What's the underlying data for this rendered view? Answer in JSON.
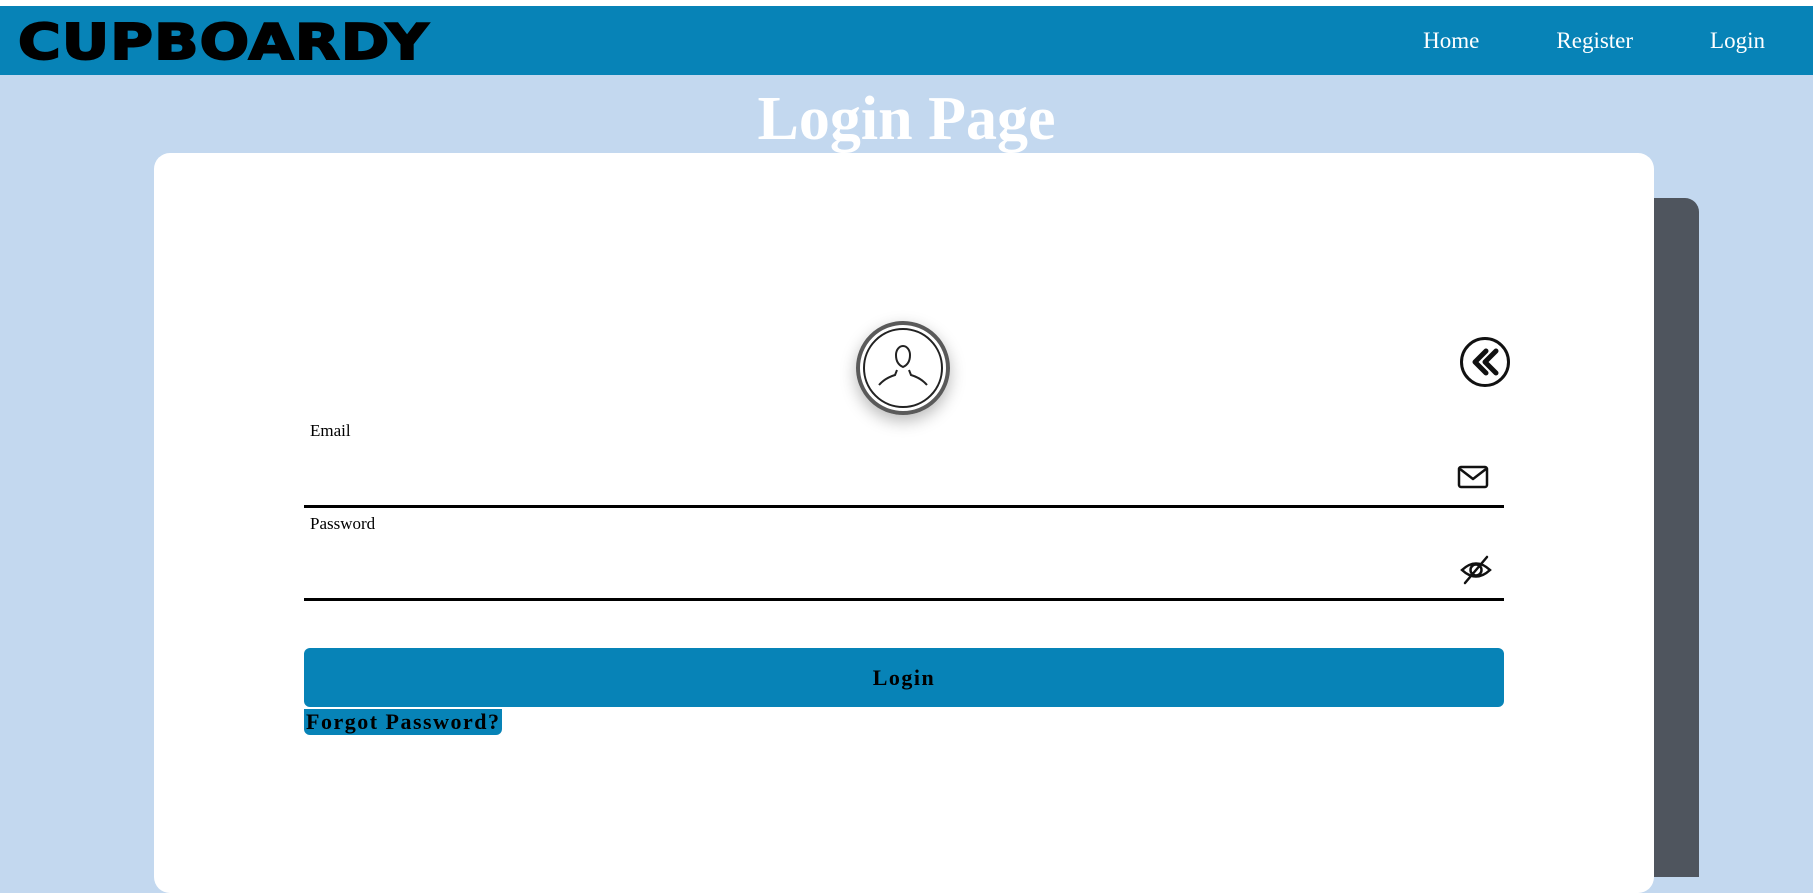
{
  "navbar": {
    "brand": "CUPBOARDY",
    "links": [
      {
        "label": "Home"
      },
      {
        "label": "Register"
      },
      {
        "label": "Login"
      }
    ],
    "background_color": "#0783b7"
  },
  "page": {
    "title": "Login Page",
    "background_color": "#c3d8ef"
  },
  "form": {
    "avatar_icon": "user-avatar-icon",
    "back_icon": "double-chevron-left-icon",
    "email": {
      "label": "Email",
      "value": "",
      "icon": "envelope-icon"
    },
    "password": {
      "label": "Password",
      "value": "",
      "icon": "eye-slash-icon"
    },
    "login_button": "Login",
    "forgot_link": "Forgot Password?",
    "accent_color": "#0783b7"
  },
  "side_panel_color": "#4f555e"
}
